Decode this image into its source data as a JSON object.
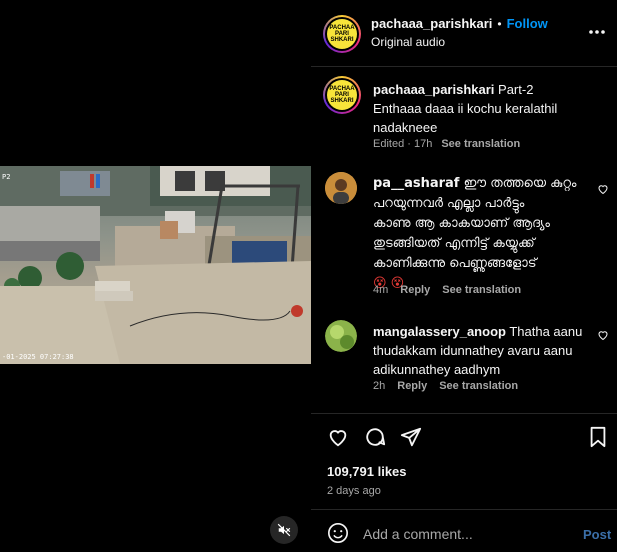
{
  "video": {
    "timestamp_overlay": "-01-2025 07:27:38",
    "corner_overlay": "P2"
  },
  "header": {
    "username": "pachaaa_parishkari",
    "separator": "•",
    "follow_label": "Follow",
    "subtitle": "Original audio",
    "menu_icon": "more-horizontal-icon"
  },
  "caption": {
    "username": "pachaaa_parishkari",
    "text_line1": "Part-2",
    "text_line2": "Enthaaa daaa ii kochu keralathil",
    "text_line3": "nadakneee",
    "edited": "Edited · 17h",
    "see_translation": "See translation"
  },
  "comments": [
    {
      "username": "pa__asharaf",
      "lines": [
        "ഈ തത്തയെ കുറ്റം",
        "പറയുന്നവർ എല്ലാ പാർട്ടും",
        "കാണു ആ കാകയാണ് ആദ്യം",
        "തുടങ്ങിയത് എന്നിട്ട് കയ്യുക്ക്",
        "കാണിക്കുന്നു പെണ്ണുങ്ങളോട്"
      ],
      "emoji": "😵 😵",
      "time": "4m",
      "reply": "Reply",
      "see_translation": "See translation"
    },
    {
      "username": "mangalassery_anoop",
      "lines": [
        "Thatha aanu",
        "thudakkam idunnathey avaru aanu",
        "adikunnathey aadhym"
      ],
      "time": "2h",
      "reply": "Reply",
      "see_translation": "See translation"
    }
  ],
  "actions": {
    "likes": "109,791 likes",
    "posted": "2 days ago"
  },
  "add_comment": {
    "placeholder": "Add a comment...",
    "post_label": "Post"
  },
  "logo_text": "PACHAA PARI SHKARI"
}
